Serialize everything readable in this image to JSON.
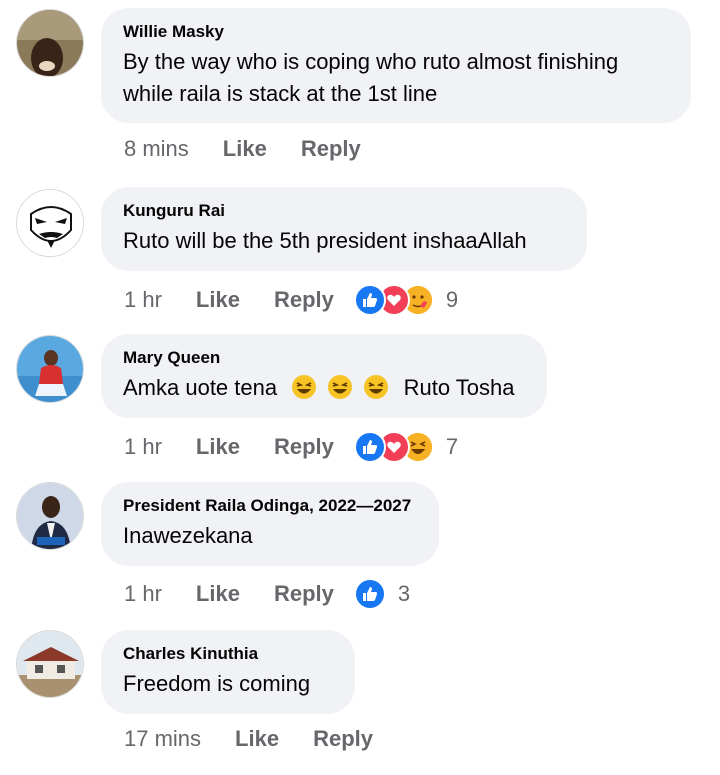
{
  "comments": [
    {
      "name": "Willie Masky",
      "text": "By the way who is coping who ruto almost finishing while raila is stack at the 1st line",
      "time": "8 mins",
      "like": "Like",
      "reply": "Reply",
      "reaction_count": ""
    },
    {
      "name": "Kunguru Rai",
      "text": "Ruto will be the 5th president inshaaAllah",
      "time": "1 hr",
      "like": "Like",
      "reply": "Reply",
      "reaction_count": "9",
      "reactions": [
        "like-icon",
        "love-icon",
        "care-icon"
      ]
    },
    {
      "name": "Mary Queen",
      "text_before": "Amka uote tena",
      "text_after": "Ruto Tosha",
      "time": "1 hr",
      "like": "Like",
      "reply": "Reply",
      "reaction_count": "7",
      "reactions": [
        "like-icon",
        "love-icon",
        "haha-icon"
      ]
    },
    {
      "name": "President Raila Odinga, 2022—2027",
      "text": "Inawezekana",
      "time": "1 hr",
      "like": "Like",
      "reply": "Reply",
      "reaction_count": "3",
      "reactions": [
        "like-icon"
      ]
    },
    {
      "name": "Charles Kinuthia",
      "text": "Freedom is coming",
      "time": "17 mins",
      "like": "Like",
      "reply": "Reply",
      "reaction_count": ""
    }
  ],
  "colors": {
    "bubble": "#f0f2f5",
    "meta": "#65676b",
    "like_blue": "#1877f2",
    "love_red": "#f33e58",
    "haha_yellow": "#f7b125"
  }
}
